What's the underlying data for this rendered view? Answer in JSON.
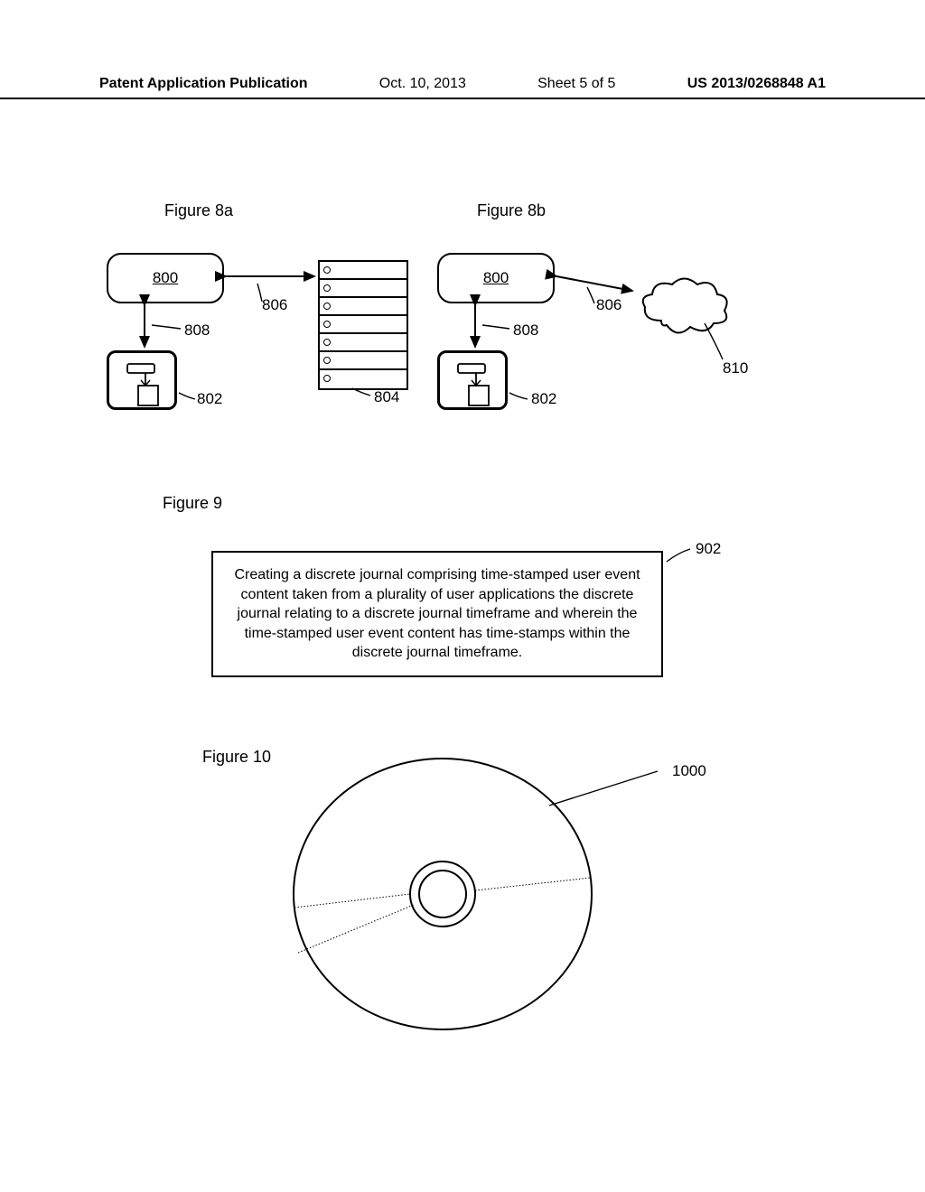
{
  "header": {
    "pub_title": "Patent Application Publication",
    "date": "Oct. 10, 2013",
    "sheet": "Sheet 5 of 5",
    "docnum": "US 2013/0268848 A1"
  },
  "figures": {
    "fig8a_label": "Figure 8a",
    "fig8b_label": "Figure 8b",
    "fig9_label": "Figure 9",
    "fig10_label": "Figure 10"
  },
  "fig8": {
    "box_800": "800",
    "ref_802": "802",
    "ref_804": "804",
    "ref_806": "806",
    "ref_808": "808",
    "ref_810": "810"
  },
  "fig9": {
    "ref_902": "902",
    "text": "Creating a discrete journal comprising time-stamped user event content taken from a plurality of user applications the discrete journal relating to a discrete journal timeframe and wherein the time-stamped user event content has time-stamps within the discrete journal timeframe."
  },
  "fig10": {
    "ref_1000": "1000"
  }
}
